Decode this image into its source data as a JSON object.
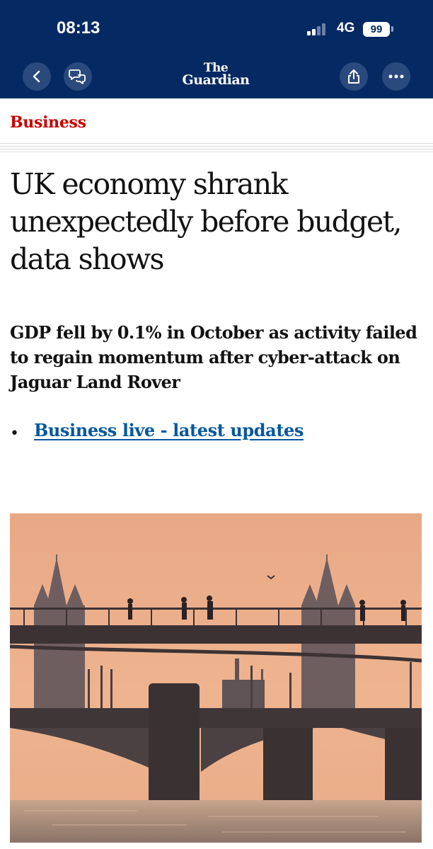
{
  "status_bar": {
    "time": "08:13",
    "network": "4G",
    "battery": "99"
  },
  "nav": {
    "back_icon": "chevron-left-icon",
    "speech_icon": "speech-bubble-icon",
    "logo_line1": "The",
    "logo_line2": "Guardian",
    "share_icon": "share-icon",
    "more_icon": "more-dots-icon"
  },
  "article": {
    "section": "Business",
    "headline": "UK economy shrank unexpectedly before budget, data shows",
    "standfirst": "GDP fell by 0.1% in October as activity failed to regain momentum after cyber-attack on Jaguar Land Rover",
    "bullet": "•",
    "link_text": "Business live - latest updates"
  },
  "colors": {
    "brand_navy": "#052962",
    "section_red": "#c70000",
    "link_blue": "#05579e"
  }
}
